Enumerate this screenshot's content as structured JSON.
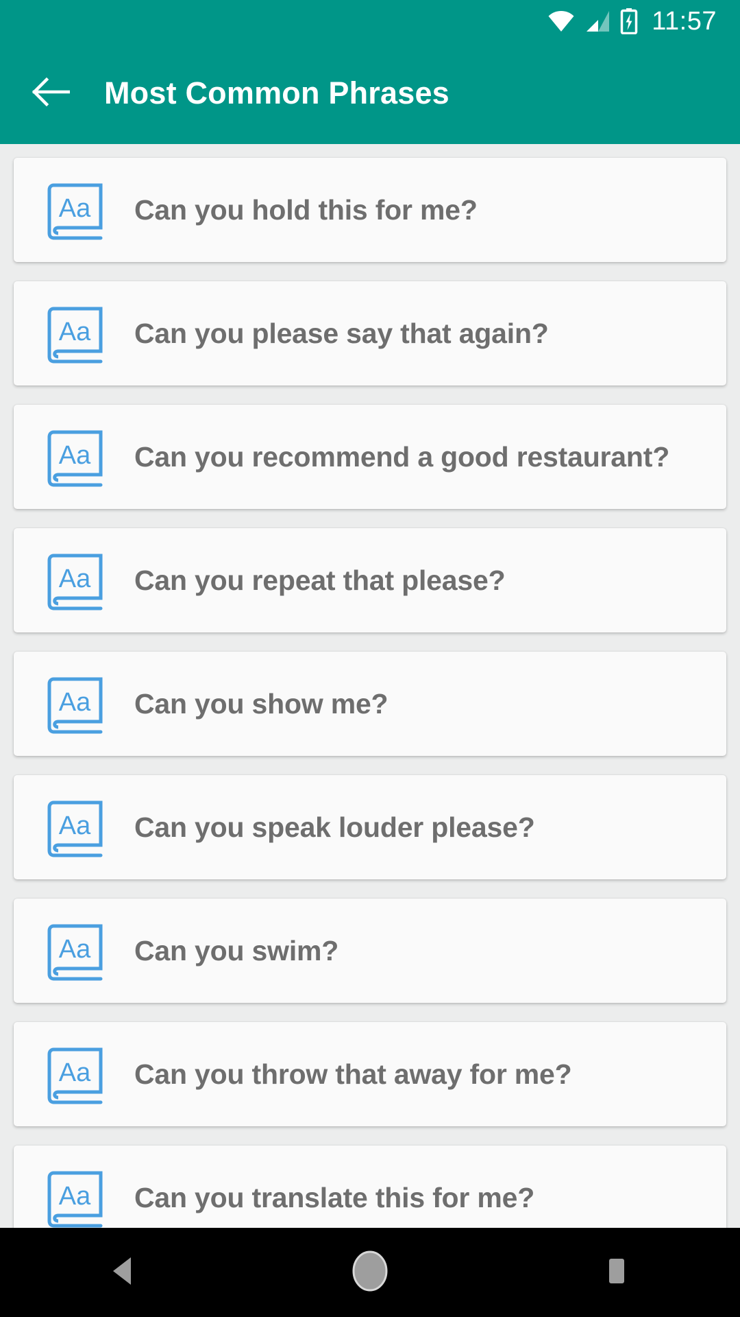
{
  "statusbar": {
    "time": "11:57",
    "icons": [
      "wifi-icon",
      "cellular-signal-icon",
      "battery-charging-icon"
    ]
  },
  "appbar": {
    "back_icon": "arrow-left-icon",
    "title": "Most Common Phrases",
    "background_color": "#009688",
    "title_color": "#ffffff"
  },
  "list": {
    "item_icon": "dictionary-book-icon",
    "item_icon_color": "#4a9fe0",
    "item_text_color": "#6e6e6e",
    "card_color": "#fafafa",
    "items": [
      {
        "label": "Can you hold this for me?"
      },
      {
        "label": "Can you please say that again?"
      },
      {
        "label": "Can you recommend a good restaurant?"
      },
      {
        "label": "Can you repeat that please?"
      },
      {
        "label": "Can you show me?"
      },
      {
        "label": "Can you speak louder please?"
      },
      {
        "label": "Can you swim?"
      },
      {
        "label": "Can you throw that away for me?"
      },
      {
        "label": "Can you translate this for me?"
      }
    ]
  },
  "navbar": {
    "background_color": "#000000",
    "buttons": [
      {
        "name": "nav-back-icon"
      },
      {
        "name": "nav-home-icon"
      },
      {
        "name": "nav-recents-icon"
      }
    ]
  }
}
